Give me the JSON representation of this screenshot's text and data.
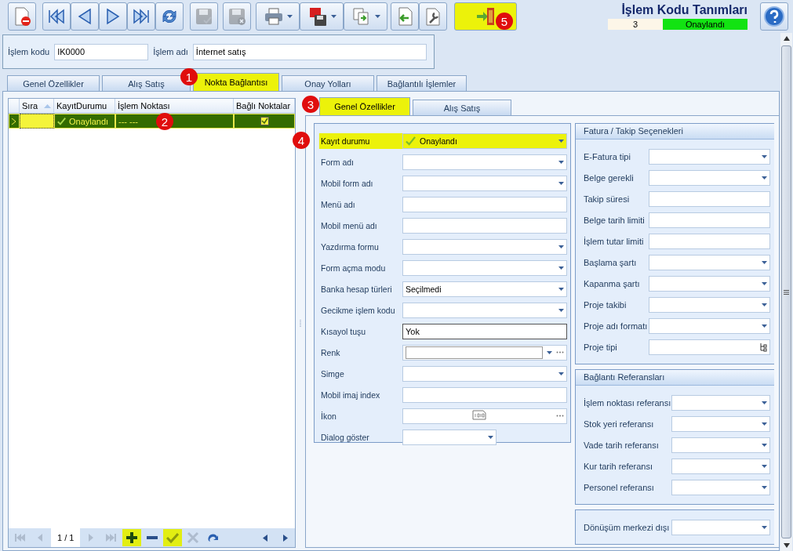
{
  "toolbar": {
    "buttons": [
      {
        "kind": "new",
        "disabled": false,
        "highlighted": false,
        "dropdown": false
      },
      {
        "kind": "first",
        "disabled": false,
        "highlighted": false,
        "dropdown": false
      },
      {
        "kind": "prev",
        "disabled": false,
        "highlighted": false,
        "dropdown": false
      },
      {
        "kind": "next",
        "disabled": false,
        "highlighted": false,
        "dropdown": false
      },
      {
        "kind": "last",
        "disabled": false,
        "highlighted": false,
        "dropdown": false
      },
      {
        "kind": "refresh",
        "disabled": false,
        "highlighted": false,
        "dropdown": false
      },
      {
        "kind": "save",
        "disabled": true,
        "highlighted": false,
        "dropdown": false
      },
      {
        "kind": "save-cancel",
        "disabled": true,
        "highlighted": false,
        "dropdown": false
      },
      {
        "kind": "print",
        "disabled": false,
        "highlighted": false,
        "dropdown": true
      },
      {
        "kind": "pdf",
        "disabled": false,
        "highlighted": false,
        "dropdown": true
      },
      {
        "kind": "export",
        "disabled": false,
        "highlighted": false,
        "dropdown": true
      },
      {
        "kind": "import",
        "disabled": false,
        "highlighted": false,
        "dropdown": false
      },
      {
        "kind": "settings",
        "disabled": false,
        "highlighted": false,
        "dropdown": false
      },
      {
        "kind": "exit",
        "disabled": false,
        "highlighted": true,
        "dropdown": false,
        "callout": "5"
      }
    ]
  },
  "header": {
    "title": "İşlem Kodu Tanımları",
    "record_no": "3",
    "status": "Onaylandı"
  },
  "record": {
    "fields": [
      {
        "label": "İşlem kodu",
        "value": "IK0000"
      },
      {
        "label": "İşlem adı",
        "value": "İnternet satış"
      }
    ]
  },
  "tabs": [
    {
      "label": "Genel Özellikler",
      "selected": false
    },
    {
      "label": "Alış Satış",
      "selected": false
    },
    {
      "label": "Nokta Bağlantısı",
      "selected": true,
      "callout": "1"
    },
    {
      "label": "Onay Yolları",
      "selected": false
    },
    {
      "label": "Bağlantılı İşlemler",
      "selected": false
    }
  ],
  "grid": {
    "columns": [
      {
        "label": "Sıra",
        "sorted": true
      },
      {
        "label": "KayıtDurumu",
        "sorted": false
      },
      {
        "label": "İşlem Noktası",
        "sorted": false
      },
      {
        "label": "Bağlı Noktalar",
        "sorted": false
      }
    ],
    "rows": [
      {
        "selected": true,
        "status": "Onaylandı",
        "point": "--- ---",
        "linked": true,
        "callout": "2"
      }
    ]
  },
  "navigator": {
    "page": "1 / 1",
    "buttons": [
      {
        "kind": "first",
        "disabled": true,
        "highlighted": false
      },
      {
        "kind": "prev",
        "disabled": true,
        "highlighted": false
      },
      {
        "kind": "page"
      },
      {
        "kind": "next",
        "disabled": true,
        "highlighted": false
      },
      {
        "kind": "last",
        "disabled": true,
        "highlighted": false
      },
      {
        "kind": "add",
        "disabled": false,
        "highlighted": true
      },
      {
        "kind": "remove",
        "disabled": false,
        "highlighted": false
      },
      {
        "kind": "apply",
        "disabled": false,
        "highlighted": true
      },
      {
        "kind": "cancel",
        "disabled": true,
        "highlighted": false
      },
      {
        "kind": "redo",
        "disabled": false,
        "highlighted": false
      }
    ]
  },
  "detail_tabs": [
    {
      "label": "Genel Özellikler",
      "selected": true,
      "callout": "3"
    },
    {
      "label": "Alış Satış",
      "selected": false
    }
  ],
  "general_fields": [
    {
      "label": "Kayıt durumu",
      "kind": "combo",
      "value": "Onaylandı",
      "approved": true,
      "highlighted": true,
      "focused": false,
      "callout": "4"
    },
    {
      "label": "Form adı",
      "kind": "combo",
      "highlighted": false,
      "focused": false
    },
    {
      "label": "Mobil form adı",
      "kind": "combo",
      "highlighted": false,
      "focused": false
    },
    {
      "label": "Menü adı",
      "kind": "text",
      "highlighted": false,
      "focused": false
    },
    {
      "label": "Mobil menü adı",
      "kind": "text",
      "highlighted": false,
      "focused": false
    },
    {
      "label": "Yazdırma formu",
      "kind": "combo",
      "highlighted": false,
      "focused": false
    },
    {
      "label": "Form açma modu",
      "kind": "combo",
      "highlighted": false,
      "focused": false
    },
    {
      "label": "Banka hesap türleri",
      "kind": "combo",
      "value": "Seçilmedi",
      "highlighted": false,
      "focused": false
    },
    {
      "label": "Gecikme işlem kodu",
      "kind": "combo",
      "highlighted": false,
      "focused": false
    },
    {
      "label": "Kısayol tuşu",
      "kind": "text",
      "value": "Yok",
      "highlighted": false,
      "focused": true
    },
    {
      "label": "Renk",
      "kind": "color",
      "highlighted": false,
      "focused": false
    },
    {
      "label": "Simge",
      "kind": "combo",
      "highlighted": false,
      "focused": false
    },
    {
      "label": "Mobil imaj index",
      "kind": "text",
      "highlighted": false,
      "focused": false
    },
    {
      "label": "İkon",
      "kind": "image",
      "highlighted": false,
      "focused": false
    },
    {
      "label": "Dialog göster",
      "kind": "short-combo",
      "highlighted": false,
      "focused": false
    }
  ],
  "groups": [
    {
      "title": "Fatura / Takip Seçenekleri",
      "fields": [
        {
          "label": "E-Fatura tipi",
          "kind": "combo"
        },
        {
          "label": "Belge gerekli",
          "kind": "combo"
        },
        {
          "label": "Takip süresi",
          "kind": "text"
        },
        {
          "label": "Belge tarih limiti",
          "kind": "text"
        },
        {
          "label": "İşlem tutar limiti",
          "kind": "text"
        },
        {
          "label": "Başlama şartı",
          "kind": "combo"
        },
        {
          "label": "Kapanma şartı",
          "kind": "combo"
        },
        {
          "label": "Proje takibi",
          "kind": "combo"
        },
        {
          "label": "Proje adı formatı",
          "kind": "combo"
        },
        {
          "label": "Proje tipi",
          "kind": "tree"
        }
      ]
    },
    {
      "title": "Bağlantı Referansları",
      "fields": [
        {
          "label": "İşlem noktası referansı",
          "kind": "combo"
        },
        {
          "label": "Stok yeri referansı",
          "kind": "combo"
        },
        {
          "label": "Vade tarih referansı",
          "kind": "combo"
        },
        {
          "label": "Kur tarih referansı",
          "kind": "combo"
        },
        {
          "label": "Personel referansı",
          "kind": "combo"
        }
      ]
    },
    {
      "fields": [
        {
          "label": "Dönüşüm merkezi dışı",
          "kind": "combo"
        }
      ]
    }
  ]
}
